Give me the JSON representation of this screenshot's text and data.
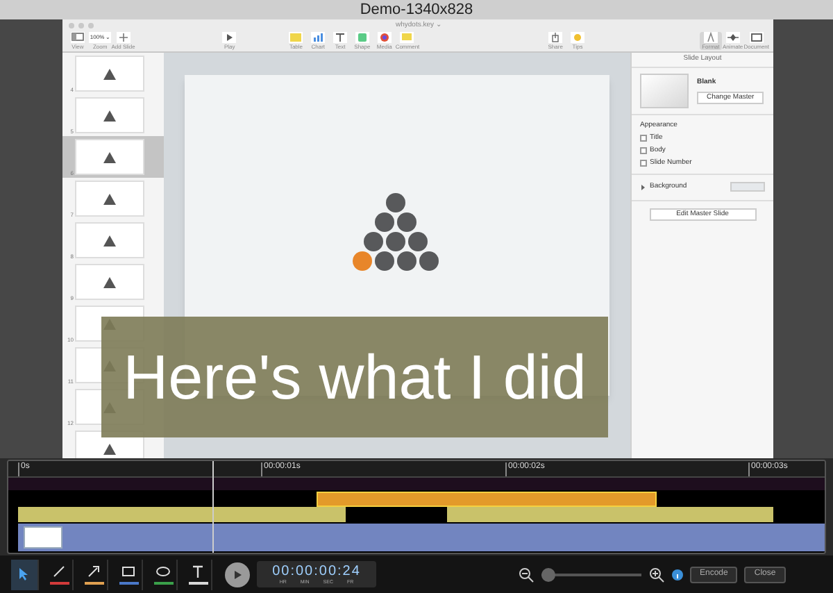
{
  "screen_title": "Demo-1340x828",
  "keynote": {
    "document_title": "whydots.key ⌄",
    "toolbar": [
      {
        "kind": "view",
        "label": "View",
        "selected": false
      },
      {
        "kind": "zoom",
        "label": "Zoom",
        "value": "100% ⌄",
        "selected": false
      },
      {
        "kind": "add",
        "label": "Add Slide",
        "selected": false
      },
      {
        "kind": "play",
        "label": "Play",
        "selected": false
      },
      {
        "kind": "table",
        "label": "Table",
        "selected": false
      },
      {
        "kind": "chart",
        "label": "Chart",
        "selected": false
      },
      {
        "kind": "text",
        "label": "Text",
        "selected": false
      },
      {
        "kind": "shape",
        "label": "Shape",
        "selected": false
      },
      {
        "kind": "media",
        "label": "Media",
        "selected": false
      },
      {
        "kind": "comment",
        "label": "Comment",
        "selected": false
      },
      {
        "kind": "share",
        "label": "Share",
        "selected": false
      },
      {
        "kind": "tips",
        "label": "Tips",
        "selected": false
      },
      {
        "kind": "format",
        "label": "Format",
        "selected": true
      },
      {
        "kind": "animate",
        "label": "Animate",
        "selected": false
      },
      {
        "kind": "document",
        "label": "Document",
        "selected": false
      }
    ],
    "slides": [
      {
        "number": "4",
        "selected": false
      },
      {
        "number": "5",
        "selected": false
      },
      {
        "number": "6",
        "selected": true
      },
      {
        "number": "7",
        "selected": false
      },
      {
        "number": "8",
        "selected": false
      },
      {
        "number": "9",
        "selected": false
      },
      {
        "number": "10",
        "selected": false
      },
      {
        "number": "11",
        "selected": false
      },
      {
        "number": "12",
        "selected": false
      },
      {
        "selected": false
      }
    ],
    "inspector": {
      "header": "Slide Layout",
      "master_name": "Blank",
      "change_master": "Change Master",
      "appearance_label": "Appearance",
      "options": [
        {
          "label": "Title",
          "checked": false
        },
        {
          "label": "Body",
          "checked": false
        },
        {
          "label": "Slide Number",
          "checked": false
        }
      ],
      "background": {
        "label": "Background",
        "expanded": false
      },
      "edit_master": "Edit Master Slide"
    }
  },
  "caption": "Here's what I did",
  "timeline": {
    "ruler": [
      "0s",
      "00:00:01s",
      "00:00:02s",
      "00:00:03s"
    ]
  },
  "tools": [
    {
      "kind": "select",
      "selected": true
    },
    {
      "kind": "line",
      "color": "#d23a3a",
      "selected": false
    },
    {
      "kind": "arrow",
      "color": "#e0a050",
      "selected": false
    },
    {
      "kind": "rect",
      "color": "#4a78c8",
      "selected": false
    },
    {
      "kind": "ellipse",
      "color": "#3aa04a",
      "selected": false
    },
    {
      "kind": "text",
      "color": "#d8d8d8",
      "selected": false
    }
  ],
  "timecode": {
    "value": "00:00:00:24",
    "units": [
      "HR",
      "MIN",
      "SEC",
      "FR"
    ]
  },
  "zoom_slider": {
    "level": 0
  },
  "buttons": [
    "Encode",
    "Close"
  ]
}
